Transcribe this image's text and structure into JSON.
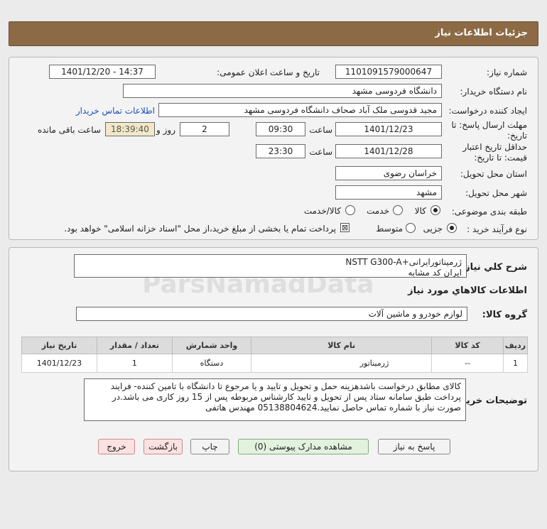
{
  "header": {
    "title": "جزئیات اطلاعات نیاز"
  },
  "form": {
    "need_number_label": "شماره نیاز:",
    "need_number": "1101091579000647",
    "announce_label": "تاریخ و ساعت اعلان عمومی:",
    "announce_value": "1401/12/20 - 14:37",
    "buyer_org_label": "نام دستگاه خریدار:",
    "buyer_org": "دانشگاه فردوسی مشهد",
    "creator_label": "ایجاد کننده درخواست:",
    "creator": "مجید قدوسی ملک آباد صحاف دانشگاه فردوسی مشهد",
    "contact_link": "اطلاعات تماس خریدار",
    "deadline_label_1": "مهلت ارسال پاسخ: تا",
    "deadline_label_2": "تاریخ:",
    "deadline_date": "1401/12/23",
    "time_word": "ساعت",
    "deadline_time": "09:30",
    "days_value": "2",
    "days_word": "روز و",
    "remaining_time": "18:39:40",
    "remaining_label": "ساعت باقی مانده",
    "validity_label_1": "حداقل تاریخ اعتبار",
    "validity_label_2": "قیمت: تا تاریخ:",
    "validity_date": "1401/12/28",
    "validity_time": "23:30",
    "province_label": "استان محل تحویل:",
    "province": "خراسان رضوی",
    "city_label": "شهر محل تحویل:",
    "city": "مشهد",
    "category_label": "طبقه بندی موضوعی:",
    "category_options": [
      "کالا",
      "خدمت",
      "کالا/خدمت"
    ],
    "process_label": "نوع فرآیند خرید :",
    "process_options": [
      "جزیی",
      "متوسط"
    ],
    "payment_text": "پرداخت تمام یا بخشی از مبلغ خرید،از محل \"اسناد خزانه اسلامی\" خواهد بود."
  },
  "description": {
    "label": "شرح کلي نياز:",
    "line1": "ژرمیناتورایرانی+NSTT G300-A",
    "line2": "ایران کد مشابه"
  },
  "goods": {
    "section_title": "اطلاعات کالاهاي مورد نياز",
    "group_label": "گروه کالا:",
    "group_value": "لوازم خودرو و ماشین آلات",
    "columns": [
      "ردیف",
      "کد کالا",
      "نام کالا",
      "واحد شمارش",
      "تعداد / مقدار",
      "تاریخ نیاز"
    ],
    "rows": [
      [
        "1",
        "--",
        "ژرمیناتور",
        "دستگاه",
        "1",
        "1401/12/23"
      ]
    ]
  },
  "buyer_notes": {
    "label": "توضیحات خریدار:",
    "text": "کالای مطابق درخواست باشدهزینه حمل و تحویل و تایید و یا مرجوع تا دانشگاه با تامین کننده- فرایند پرداخت طبق سامانه ستاد پس از تحویل و تایید کارشناس مربوطه پس از 15 روز کاری می باشد.در صورت نیاز با شماره تماس حاصل نمایید.05138804624 مهندس هاتفی"
  },
  "buttons": {
    "reply": "پاسخ به نیاز",
    "attachments": "مشاهده مدارک پیوستی (0)",
    "print": "چاپ",
    "back": "بازگشت",
    "exit": "خروج"
  }
}
